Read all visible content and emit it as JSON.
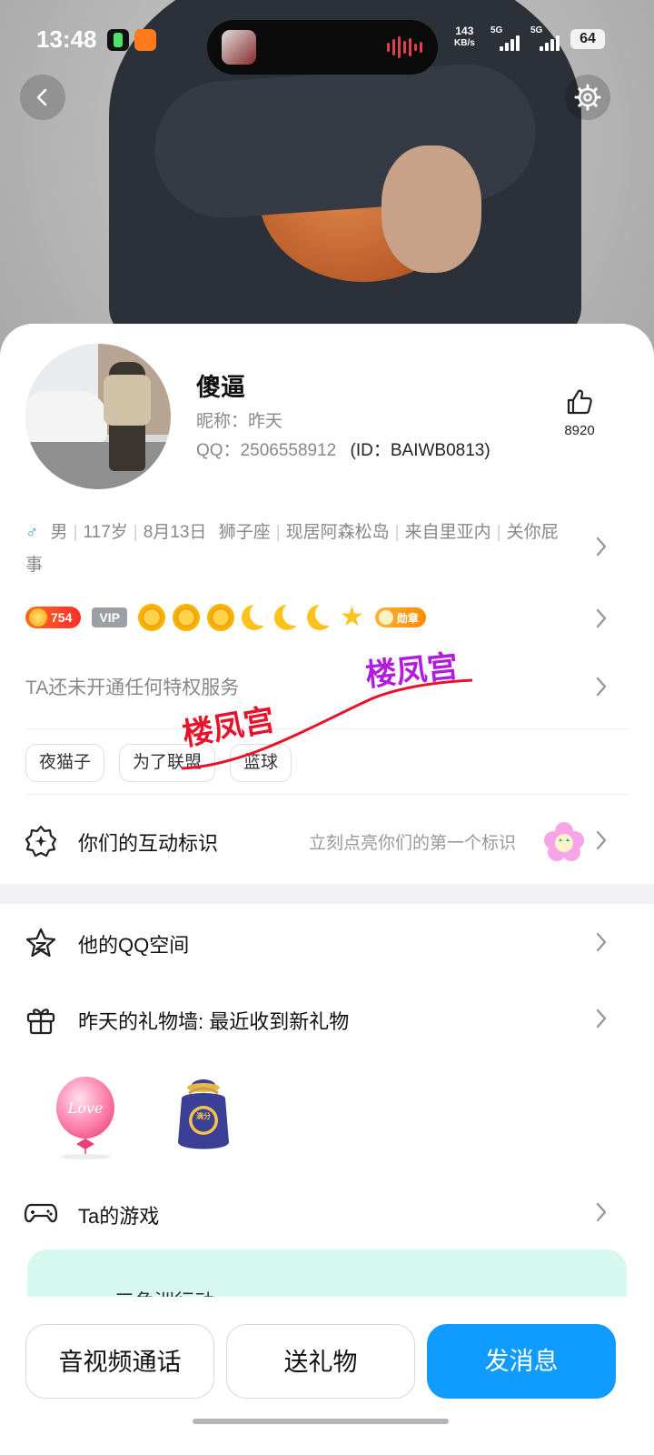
{
  "status_bar": {
    "time": "13:48",
    "net_speed_value": "143",
    "net_speed_unit": "KB/s",
    "signal1": "5G",
    "signal2": "5G",
    "battery": "64"
  },
  "profile": {
    "name": "傻逼",
    "nickname": "昵称：昨天",
    "qq": "QQ：2506558912",
    "id": "(ID：BAIWB0813)",
    "likes": "8920"
  },
  "info": {
    "gender_symbol": "♂",
    "gender": "男",
    "age": "117岁",
    "birthday": "8月13日",
    "zodiac": "狮子座",
    "residence": "现居阿森松岛",
    "origin": "来自里亚内",
    "signature": "关你屁事"
  },
  "badges": {
    "level_value": "754",
    "vip_label": "VIP",
    "medal_label": "勋章",
    "level_icons": [
      "sun",
      "sun",
      "sun",
      "moon",
      "moon",
      "moon",
      "star"
    ]
  },
  "privilege_text": "TA还未开通任何特权服务",
  "tags": [
    "夜猫子",
    "为了联盟",
    "篮球"
  ],
  "interaction": {
    "label": "你们的互动标识",
    "hint": "立刻点亮你们的第一个标识"
  },
  "rows": {
    "qzone": "他的QQ空间",
    "gift_wall": "昨天的礼物墙: 最近收到新礼物",
    "games": "Ta的游戏"
  },
  "gifts": [
    {
      "icon": "love-balloon",
      "text": "Love"
    },
    {
      "icon": "lucky-bag",
      "text": "满分"
    }
  ],
  "game_card_text": "三角洲行动",
  "watermark": "楼凤宫",
  "actions": {
    "call": "音视频通话",
    "gift": "送礼物",
    "message": "发消息"
  },
  "colors": {
    "primary": "#0f9bff",
    "gender": "#2aa6e0",
    "level_badge": "#ff4a1f",
    "watermark_red": "#e8132b",
    "watermark_purple": "#b21bdb"
  }
}
